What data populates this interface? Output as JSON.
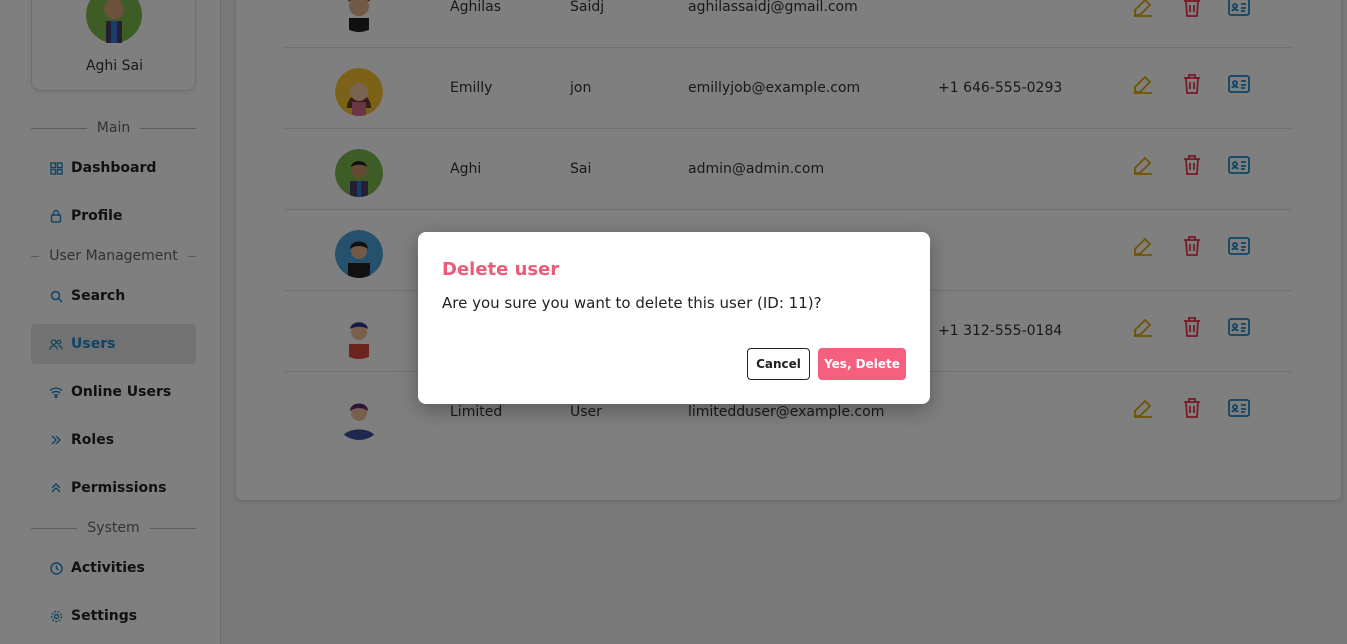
{
  "profile": {
    "name": "Aghi Sai"
  },
  "sections": {
    "main": "Main",
    "user_management": "User Management",
    "system": "System"
  },
  "nav": {
    "dashboard": "Dashboard",
    "profile": "Profile",
    "search": "Search",
    "users": "Users",
    "online_users": "Online Users",
    "roles": "Roles",
    "permissions": "Permissions",
    "activities": "Activities",
    "settings": "Settings"
  },
  "users": [
    {
      "first_name": "Aghilas",
      "last_name": "Saidj",
      "email": "aghilassaidj@gmail.com",
      "phone": ""
    },
    {
      "first_name": "Emilly",
      "last_name": "jon",
      "email": "emillyjob@example.com",
      "phone": "+1 646-555-0293"
    },
    {
      "first_name": "Aghi",
      "last_name": "Sai",
      "email": "admin@admin.com",
      "phone": ""
    },
    {
      "first_name": "",
      "last_name": "",
      "email": "",
      "phone": ""
    },
    {
      "first_name": "",
      "last_name": "",
      "email": "",
      "phone": "+1 312-555-0184"
    },
    {
      "first_name": "Limited",
      "last_name": "User",
      "email": "limitedduser@example.com",
      "phone": ""
    }
  ],
  "icons": {
    "edit": "edit-icon",
    "delete": "trash-icon",
    "details": "id-card-icon"
  },
  "colors": {
    "edit": "#e0a800",
    "delete": "#e8384f",
    "details": "#1e88c8",
    "modal_title": "#ec5b78",
    "confirm": "#f4607e"
  },
  "modal": {
    "title": "Delete user",
    "message": "Are you sure you want to delete this user (ID: 11)?",
    "cancel_label": "Cancel",
    "confirm_label": "Yes, Delete"
  }
}
